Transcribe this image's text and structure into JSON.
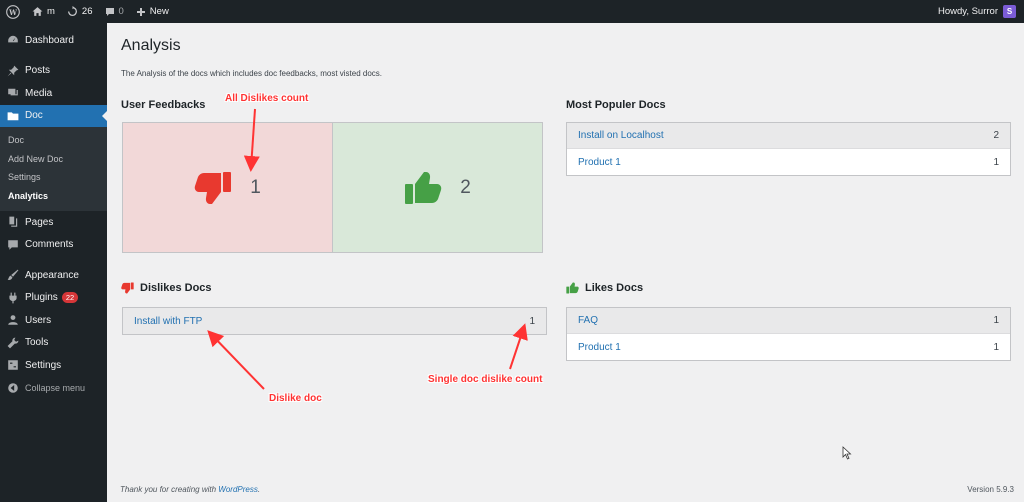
{
  "adminbar": {
    "site_name": "m",
    "updates_count": "26",
    "comments_count": "0",
    "new_label": "New",
    "howdy": "Howdy, Surror",
    "avatar_letter": "S"
  },
  "sidebar": {
    "dashboard": "Dashboard",
    "posts": "Posts",
    "media": "Media",
    "doc": "Doc",
    "doc_sub": [
      "Doc",
      "Add New Doc",
      "Settings",
      "Analytics"
    ],
    "pages": "Pages",
    "comments": "Comments",
    "appearance": "Appearance",
    "plugins": "Plugins",
    "plugins_badge": "22",
    "users": "Users",
    "tools": "Tools",
    "settings": "Settings",
    "collapse": "Collapse menu"
  },
  "main": {
    "title": "Analysis",
    "description": "The Analysis of the docs which includes doc feedbacks, most visted docs.",
    "user_feedbacks_title": "User Feedbacks",
    "dislike_count": "1",
    "like_count": "2",
    "most_popular_title": "Most Populer Docs",
    "most_popular": [
      {
        "name": "Install on Localhost",
        "count": "2"
      },
      {
        "name": "Product 1",
        "count": "1"
      }
    ],
    "dislikes_title": "Dislikes Docs",
    "dislikes": [
      {
        "name": "Install with FTP",
        "count": "1"
      }
    ],
    "likes_title": "Likes Docs",
    "likes": [
      {
        "name": "FAQ",
        "count": "1"
      },
      {
        "name": "Product 1",
        "count": "1"
      }
    ]
  },
  "annotations": {
    "all_dislikes": "All Dislikes count",
    "dislike_doc": "Dislike doc",
    "single_doc": "Single doc dislike count"
  },
  "footer": {
    "thanks_prefix": "Thank you for creating with ",
    "wp_link": "WordPress",
    "thanks_suffix": ".",
    "version": "Version 5.9.3"
  },
  "colors": {
    "accent": "#2271b1",
    "dislike": "#e8392f",
    "like": "#46a046",
    "annotation": "#ff3333"
  }
}
